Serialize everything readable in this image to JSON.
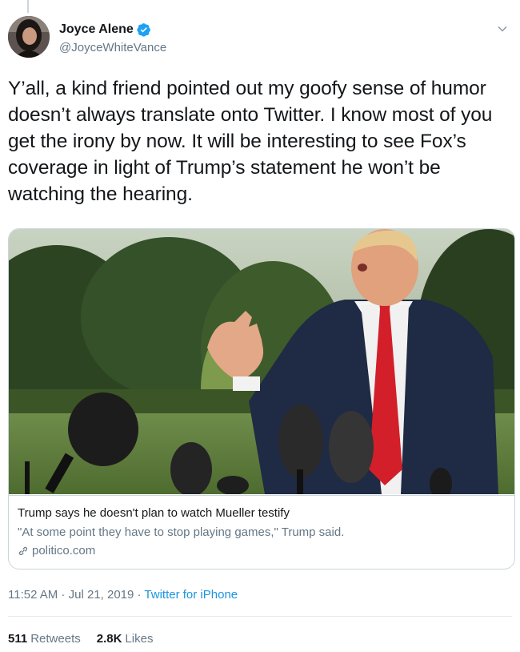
{
  "author": {
    "name": "Joyce Alene",
    "handle": "@JoyceWhiteVance",
    "verified": true,
    "icon": "verified-badge-icon"
  },
  "tweet": {
    "text": "Y’all, a kind friend pointed out my goofy sense of humor doesn’t always translate onto Twitter. I know most of you get the irony by now. It will be interesting to see Fox’s coverage in light of Trump’s statement he won’t be watching the hearing."
  },
  "card": {
    "title": "Trump says he doesn't plan to watch Mueller testify",
    "description": "\"At some point they have to stop playing games,\" Trump said.",
    "domain": "politico.com"
  },
  "meta": {
    "time": "11:52 AM",
    "separator": " · ",
    "date": "Jul 21, 2019",
    "source": "Twitter for iPhone"
  },
  "stats": {
    "retweets_count": "511",
    "retweets_label": "Retweets",
    "likes_count": "2.8K",
    "likes_label": "Likes"
  },
  "colors": {
    "link": "#1b95e0",
    "secondary_text": "#657786",
    "border": "#ccd6dd"
  }
}
